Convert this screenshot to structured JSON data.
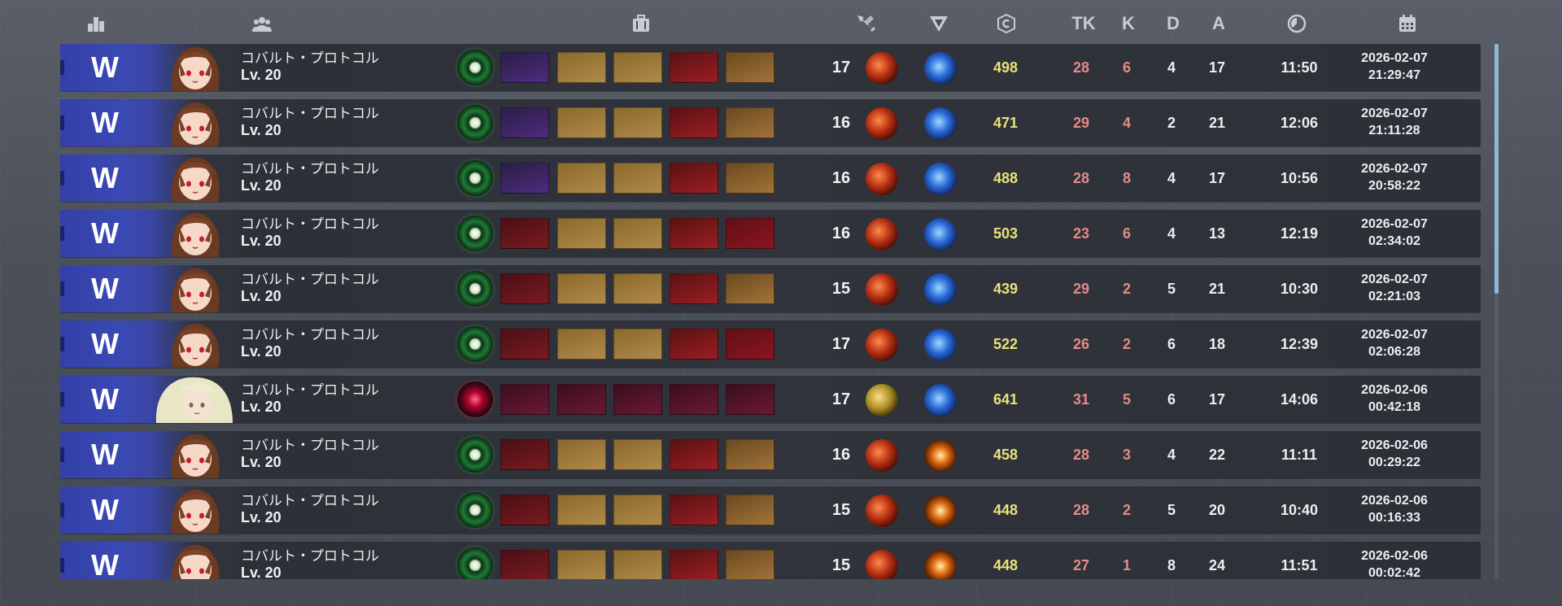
{
  "header": {
    "icons": [
      "rank-icon",
      "team-icon",
      "inventory-icon",
      "weapon-icon",
      "skill-icon",
      "credit-icon",
      "stopwatch-icon",
      "calendar-icon"
    ],
    "tk_label": "TK",
    "k_label": "K",
    "d_label": "D",
    "a_label": "A"
  },
  "matches": [
    {
      "result": "W",
      "name": "コバルト・プロトコル",
      "level_label": "Lv. 20",
      "char_level": "17",
      "credits": "498",
      "tk": "28",
      "k": "6",
      "d": "4",
      "a": "17",
      "duration": "11:50",
      "date": "2026-02-07",
      "time": "21:29:47",
      "avatar": "brown-hair-girl",
      "weapon": "green-orb",
      "items": [
        "purple",
        "gold",
        "gold",
        "red",
        "brown"
      ],
      "skill2": "blue"
    },
    {
      "result": "W",
      "name": "コバルト・プロトコル",
      "level_label": "Lv. 20",
      "char_level": "16",
      "credits": "471",
      "tk": "29",
      "k": "4",
      "d": "2",
      "a": "21",
      "duration": "12:06",
      "date": "2026-02-07",
      "time": "21:11:28",
      "avatar": "brown-hair-girl",
      "weapon": "green-orb",
      "items": [
        "purple",
        "gold",
        "gold",
        "red",
        "brown"
      ],
      "skill2": "blue"
    },
    {
      "result": "W",
      "name": "コバルト・プロトコル",
      "level_label": "Lv. 20",
      "char_level": "16",
      "credits": "488",
      "tk": "28",
      "k": "8",
      "d": "4",
      "a": "17",
      "duration": "10:56",
      "date": "2026-02-07",
      "time": "20:58:22",
      "avatar": "brown-hair-girl",
      "weapon": "green-orb",
      "items": [
        "purple",
        "gold",
        "gold",
        "red",
        "brown"
      ],
      "skill2": "blue"
    },
    {
      "result": "W",
      "name": "コバルト・プロトコル",
      "level_label": "Lv. 20",
      "char_level": "16",
      "credits": "503",
      "tk": "23",
      "k": "6",
      "d": "4",
      "a": "13",
      "duration": "12:19",
      "date": "2026-02-07",
      "time": "02:34:02",
      "avatar": "brown-hair-girl",
      "weapon": "green-orb",
      "items": [
        "darkred",
        "gold",
        "gold",
        "red",
        "deepred"
      ],
      "skill2": "blue"
    },
    {
      "result": "W",
      "name": "コバルト・プロトコル",
      "level_label": "Lv. 20",
      "char_level": "15",
      "credits": "439",
      "tk": "29",
      "k": "2",
      "d": "5",
      "a": "21",
      "duration": "10:30",
      "date": "2026-02-07",
      "time": "02:21:03",
      "avatar": "brown-hair-girl",
      "weapon": "green-orb",
      "items": [
        "darkred",
        "gold",
        "gold",
        "red",
        "brown"
      ],
      "skill2": "blue"
    },
    {
      "result": "W",
      "name": "コバルト・プロトコル",
      "level_label": "Lv. 20",
      "char_level": "17",
      "credits": "522",
      "tk": "26",
      "k": "2",
      "d": "6",
      "a": "18",
      "duration": "12:39",
      "date": "2026-02-07",
      "time": "02:06:28",
      "avatar": "brown-hair-girl",
      "weapon": "green-orb",
      "items": [
        "darkred",
        "gold",
        "gold",
        "red",
        "deepred"
      ],
      "skill2": "blue"
    },
    {
      "result": "W",
      "name": "コバルト・プロトコル",
      "level_label": "Lv. 20",
      "char_level": "17",
      "credits": "641",
      "tk": "31",
      "k": "5",
      "d": "6",
      "a": "17",
      "duration": "14:06",
      "date": "2026-02-06",
      "time": "00:42:18",
      "avatar": "blonde-hair-girl",
      "weapon": "red-orb",
      "items": [
        "violet",
        "violet",
        "violet",
        "violet",
        "violet"
      ],
      "skill2": "blue"
    },
    {
      "result": "W",
      "name": "コバルト・プロトコル",
      "level_label": "Lv. 20",
      "char_level": "16",
      "credits": "458",
      "tk": "28",
      "k": "3",
      "d": "4",
      "a": "22",
      "duration": "11:11",
      "date": "2026-02-06",
      "time": "00:29:22",
      "avatar": "brown-hair-girl",
      "weapon": "green-orb",
      "items": [
        "darkred",
        "gold",
        "gold",
        "red",
        "brown"
      ],
      "skill2": "orange"
    },
    {
      "result": "W",
      "name": "コバルト・プロトコル",
      "level_label": "Lv. 20",
      "char_level": "15",
      "credits": "448",
      "tk": "28",
      "k": "2",
      "d": "5",
      "a": "20",
      "duration": "10:40",
      "date": "2026-02-06",
      "time": "00:16:33",
      "avatar": "brown-hair-girl",
      "weapon": "green-orb",
      "items": [
        "darkred",
        "gold",
        "gold",
        "red",
        "brown"
      ],
      "skill2": "orange"
    },
    {
      "result": "W",
      "name": "コバルト・プロトコル",
      "level_label": "Lv. 20",
      "char_level": "15",
      "credits": "448",
      "tk": "27",
      "k": "1",
      "d": "8",
      "a": "24",
      "duration": "11:51",
      "date": "2026-02-06",
      "time": "00:02:42",
      "avatar": "brown-hair-girl",
      "weapon": "green-orb",
      "items": [
        "darkred",
        "gold",
        "gold",
        "red",
        "brown"
      ],
      "skill2": "orange"
    }
  ],
  "colors": {
    "win": "#3b49b4",
    "credits": "#e9e27a",
    "tk": "#e58a88",
    "scrollbar": "#8fb8d8"
  }
}
